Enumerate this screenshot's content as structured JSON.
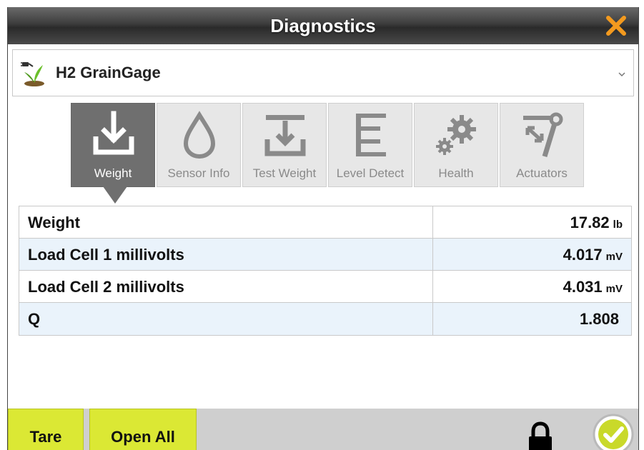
{
  "window": {
    "title": "Diagnostics",
    "close_icon": "close-icon",
    "accent": "#f39a1f"
  },
  "device": {
    "name": "H2 GrainGage",
    "icon": "plant-plug-icon"
  },
  "tabs": [
    {
      "label": "Weight",
      "icon": "download-tray-icon",
      "active": true
    },
    {
      "label": "Sensor Info",
      "icon": "droplet-icon",
      "active": false
    },
    {
      "label": "Test Weight",
      "icon": "test-weight-icon",
      "active": false
    },
    {
      "label": "Level Detect",
      "icon": "level-detect-icon",
      "active": false
    },
    {
      "label": "Health",
      "icon": "gears-icon",
      "active": false
    },
    {
      "label": "Actuators",
      "icon": "actuator-arm-icon",
      "active": false
    }
  ],
  "readings": [
    {
      "name": "Weight",
      "value": "17.82",
      "unit": "lb"
    },
    {
      "name": "Load Cell 1 millivolts",
      "value": "4.017",
      "unit": "mV"
    },
    {
      "name": "Load Cell 2 millivolts",
      "value": "4.031",
      "unit": "mV"
    },
    {
      "name": "Q",
      "value": "1.808",
      "unit": ""
    }
  ],
  "footer": {
    "tare_label": "Tare",
    "open_all_label": "Open All",
    "button_color": "#dbe834",
    "lock_icon": "lock-icon",
    "confirm_icon": "checkmark-circle-icon"
  }
}
